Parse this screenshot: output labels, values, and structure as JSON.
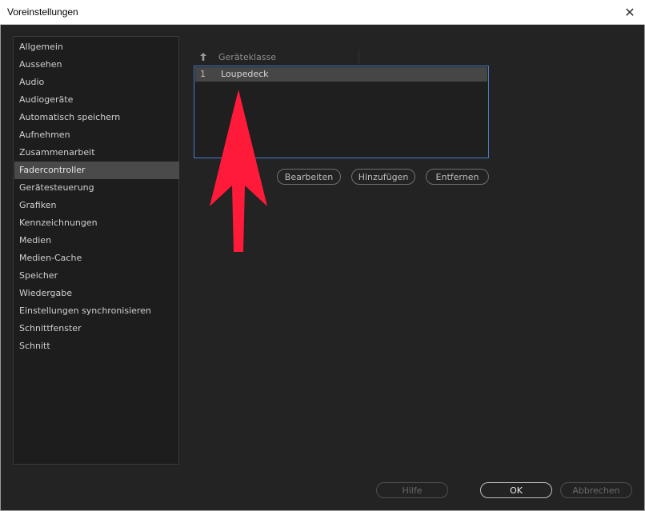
{
  "window": {
    "title": "Voreinstellungen",
    "close_glyph": "✕"
  },
  "sidebar": {
    "items": [
      {
        "label": "Allgemein"
      },
      {
        "label": "Aussehen"
      },
      {
        "label": "Audio"
      },
      {
        "label": "Audiogeräte"
      },
      {
        "label": "Automatisch speichern"
      },
      {
        "label": "Aufnehmen"
      },
      {
        "label": "Zusammenarbeit"
      },
      {
        "label": "Fadercontroller"
      },
      {
        "label": "Gerätesteuerung"
      },
      {
        "label": "Grafiken"
      },
      {
        "label": "Kennzeichnungen"
      },
      {
        "label": "Medien"
      },
      {
        "label": "Medien-Cache"
      },
      {
        "label": "Speicher"
      },
      {
        "label": "Wiedergabe"
      },
      {
        "label": "Einstellungen synchronisieren"
      },
      {
        "label": "Schnittfenster"
      },
      {
        "label": "Schnitt"
      }
    ],
    "selected": "Fadercontroller"
  },
  "table": {
    "sort_icon": "arrow-up-icon",
    "column_header": "Geräteklasse",
    "rows": [
      {
        "index": "1",
        "value": "Loupedeck"
      }
    ]
  },
  "actions": {
    "edit_label": "Bearbeiten",
    "add_label": "Hinzufügen",
    "remove_label": "Entfernen"
  },
  "footer": {
    "help_label": "Hilfe",
    "ok_label": "OK",
    "cancel_label": "Abbrechen"
  },
  "annotation": {
    "icon": "red-arrow-icon",
    "color": "#ff1a3a"
  },
  "colors": {
    "background": "#232323",
    "selection_border": "#4a7ecb",
    "sidebar_active": "#4a4a4a"
  }
}
